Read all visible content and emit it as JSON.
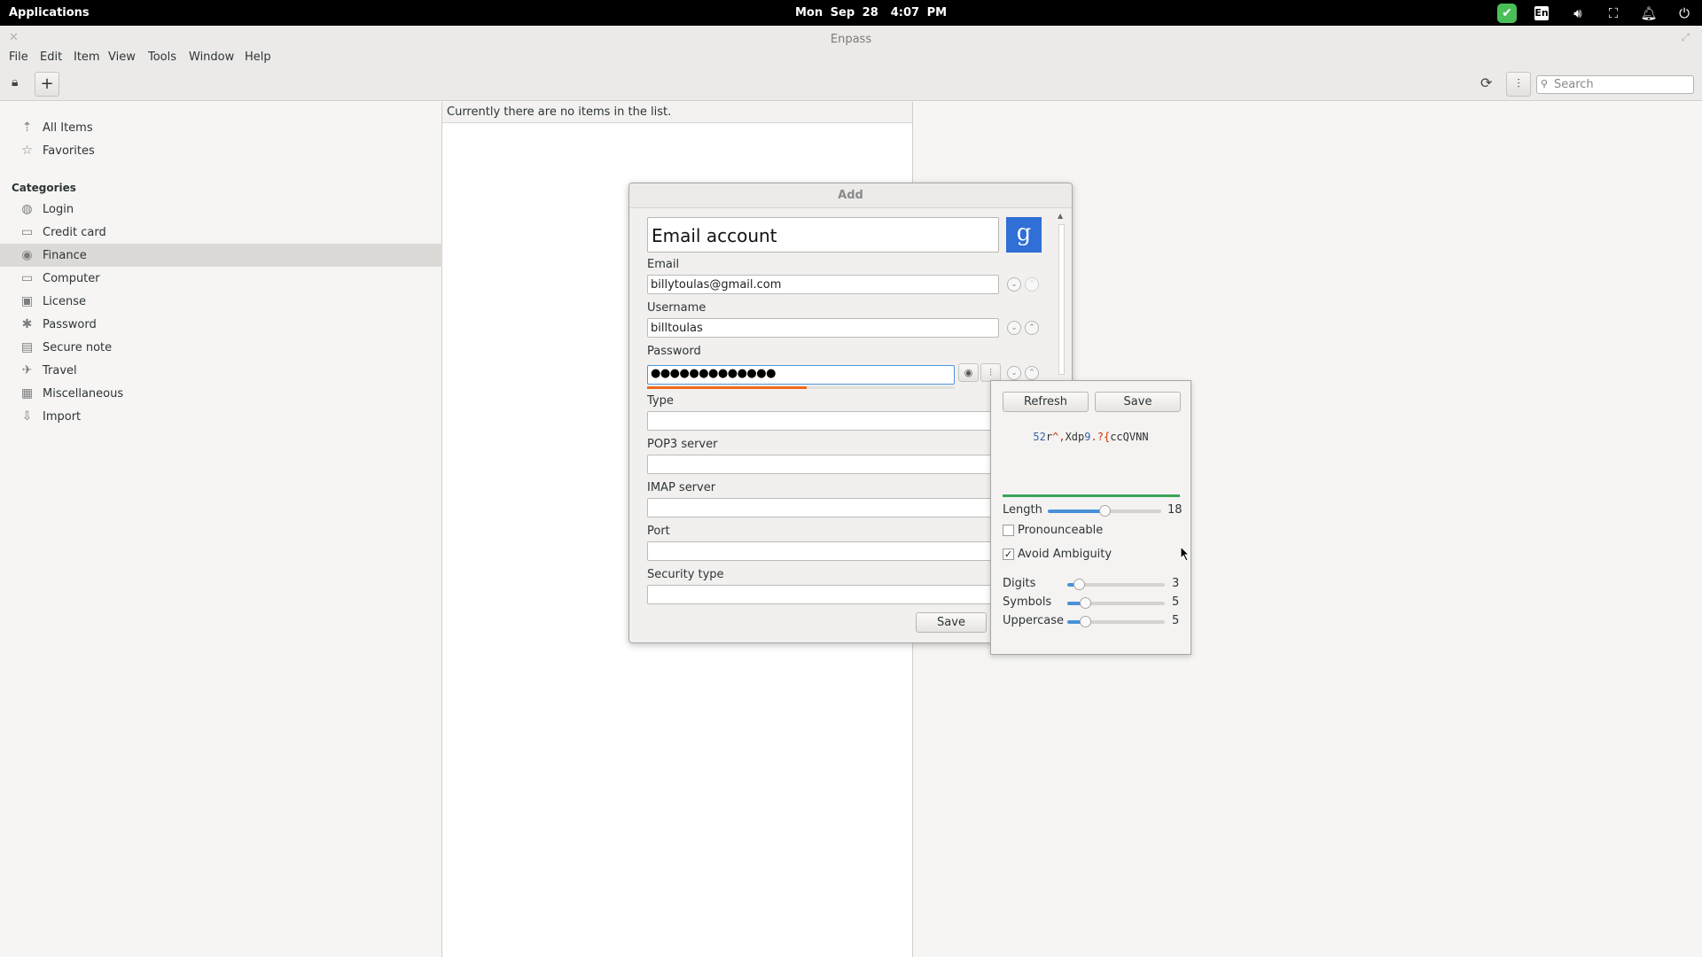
{
  "topbar": {
    "applications": "Applications",
    "date": "Mon Sep 28",
    "time": "4:07 PM",
    "lang": "En"
  },
  "window": {
    "title": "Enpass"
  },
  "menu": [
    "File",
    "Edit",
    "Item",
    "View",
    "Tools",
    "Window",
    "Help"
  ],
  "toolbar": {
    "search_placeholder": "Search"
  },
  "sidebar": {
    "top_items": [
      {
        "label": "All Items",
        "icon": "all-items-icon"
      },
      {
        "label": "Favorites",
        "icon": "star-icon"
      }
    ],
    "categories_heading": "Categories",
    "categories": [
      {
        "label": "Login",
        "icon": "globe-icon"
      },
      {
        "label": "Credit card",
        "icon": "credit-card-icon"
      },
      {
        "label": "Finance",
        "icon": "finance-icon",
        "selected": true
      },
      {
        "label": "Computer",
        "icon": "computer-icon"
      },
      {
        "label": "License",
        "icon": "license-icon"
      },
      {
        "label": "Password",
        "icon": "password-icon"
      },
      {
        "label": "Secure note",
        "icon": "note-icon"
      },
      {
        "label": "Travel",
        "icon": "plane-icon"
      },
      {
        "label": "Miscellaneous",
        "icon": "misc-icon"
      },
      {
        "label": "Import",
        "icon": "import-icon"
      }
    ]
  },
  "list": {
    "empty_message": "Currently there are no items in the list."
  },
  "dialog": {
    "title": "Add",
    "name": "Email account",
    "email_label": "Email",
    "email_value": "billytoulas@gmail.com",
    "username_label": "Username",
    "username_value": "billtoulas",
    "password_label": "Password",
    "password_value": "●●●●●●●●●●●●●",
    "password_strength": 0.52,
    "type_label": "Type",
    "pop3_label": "POP3 server",
    "imap_label": "IMAP server",
    "port_label": "Port",
    "security_label": "Security type",
    "save_label": "Save"
  },
  "generator": {
    "refresh_label": "Refresh",
    "save_label": "Save",
    "generated_parts": [
      {
        "t": "52",
        "c": "d"
      },
      {
        "t": "r",
        "c": "l"
      },
      {
        "t": "^",
        "c": "s"
      },
      {
        "t": ",",
        "c": "s"
      },
      {
        "t": "Xdp",
        "c": "l"
      },
      {
        "t": "9",
        "c": "d"
      },
      {
        "t": ".",
        "c": "s"
      },
      {
        "t": "?",
        "c": "s"
      },
      {
        "t": "{",
        "c": "s"
      },
      {
        "t": "ccQVNN",
        "c": "l"
      }
    ],
    "length_label": "Length",
    "length_value": "18",
    "length_fraction": 0.5,
    "pronounceable_label": "Pronounceable",
    "pronounceable_checked": false,
    "avoid_label": "Avoid Ambiguity",
    "avoid_checked": true,
    "digits_label": "Digits",
    "digits_value": "3",
    "digits_fraction": 0.12,
    "symbols_label": "Symbols",
    "symbols_value": "5",
    "symbols_fraction": 0.18,
    "uppercase_label": "Uppercase",
    "uppercase_value": "5",
    "uppercase_fraction": 0.18
  }
}
